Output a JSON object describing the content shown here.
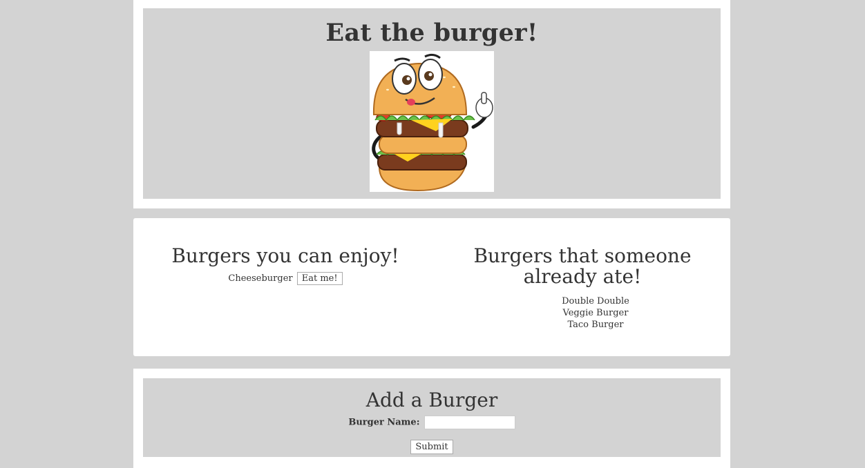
{
  "header": {
    "title": "Eat the burger!",
    "image_name": "burger-mascot"
  },
  "available": {
    "heading": "Burgers you can enjoy!",
    "items": [
      {
        "name": "Cheeseburger",
        "button_label": "Eat me!"
      }
    ]
  },
  "eaten": {
    "heading": "Burgers that someone already ate!",
    "items": [
      "Double Double",
      "Veggie Burger",
      "Taco Burger"
    ]
  },
  "form": {
    "title": "Add a Burger",
    "label": "Burger Name:",
    "input_value": "",
    "submit_label": "Submit"
  },
  "colors": {
    "background": "#d3d3d3",
    "card": "#ffffff",
    "text": "#333333",
    "bun": "#f2b055",
    "patty": "#7a3b1e",
    "lettuce": "#6cc24a",
    "tomato": "#e53a2a",
    "cheese": "#ffd21f"
  }
}
